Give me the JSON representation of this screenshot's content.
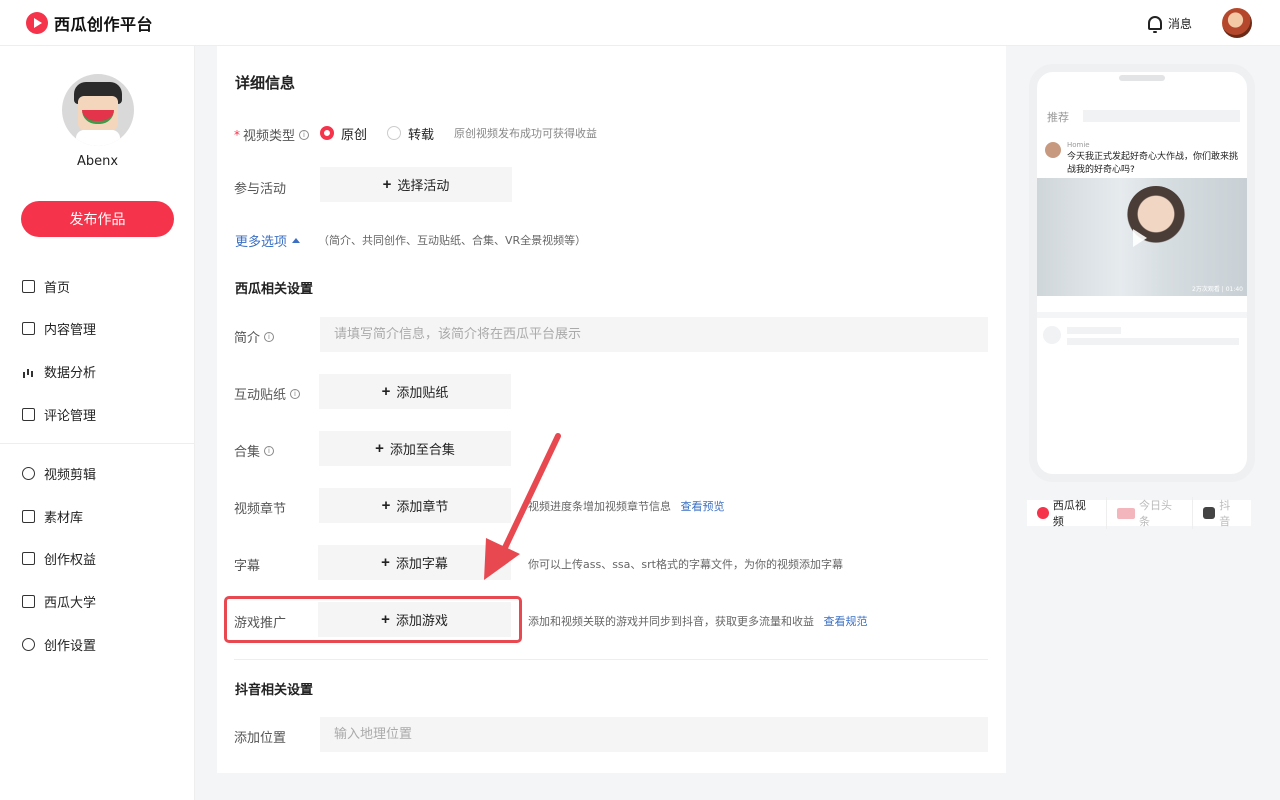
{
  "brand": {
    "name": "西瓜创作平台"
  },
  "topbar": {
    "messages_label": "消息"
  },
  "sidebar": {
    "username": "Abenx",
    "publish_label": "发布作品",
    "nav_group1": [
      {
        "label": "首页",
        "icon": "home-icon"
      },
      {
        "label": "内容管理",
        "icon": "content-icon"
      },
      {
        "label": "数据分析",
        "icon": "chart-icon"
      },
      {
        "label": "评论管理",
        "icon": "comment-icon"
      }
    ],
    "nav_group2": [
      {
        "label": "视频剪辑",
        "icon": "scissors-icon"
      },
      {
        "label": "素材库",
        "icon": "layers-icon"
      },
      {
        "label": "创作权益",
        "icon": "crown-icon"
      },
      {
        "label": "西瓜大学",
        "icon": "presentation-icon"
      },
      {
        "label": "创作设置",
        "icon": "settings-icon"
      }
    ]
  },
  "form": {
    "title": "详细信息",
    "video_type": {
      "label": "视频类型",
      "options": [
        "原创",
        "转载"
      ],
      "selected": "原创",
      "hint": "原创视频发布成功可获得收益"
    },
    "activity": {
      "label": "参与活动",
      "button": "选择活动"
    },
    "more_options": {
      "label": "更多选项",
      "hint": "（简介、共同创作、互动贴纸、合集、VR全景视频等）"
    },
    "xigua_section": "西瓜相关设置",
    "intro": {
      "label": "简介",
      "placeholder": "请填写简介信息，该简介将在西瓜平台展示"
    },
    "sticker": {
      "label": "互动贴纸",
      "button": "添加贴纸"
    },
    "collection": {
      "label": "合集",
      "button": "添加至合集"
    },
    "chapter": {
      "label": "视频章节",
      "button": "添加章节",
      "hint": "视频进度条增加视频章节信息",
      "link": "查看预览"
    },
    "subtitle": {
      "label": "字幕",
      "button": "添加字幕",
      "hint": "你可以上传ass、ssa、srt格式的字幕文件，为你的视频添加字幕"
    },
    "game": {
      "label": "游戏推广",
      "button": "添加游戏",
      "hint": "添加和视频关联的游戏并同步到抖音，获取更多流量和收益",
      "link": "查看规范"
    },
    "douyin_section": "抖音相关设置",
    "location": {
      "label": "添加位置",
      "placeholder": "输入地理位置"
    }
  },
  "preview": {
    "tab_label": "推荐",
    "author": "Homie",
    "post_text": "今天我正式发起好奇心大作战，你们敢来挑战我的好奇心吗?",
    "video_meta": "2万次观看 | 01:40",
    "platforms": [
      "西瓜视频",
      "今日头条",
      "抖音"
    ]
  },
  "colors": {
    "accent": "#f5334a",
    "link": "#3a6fc4",
    "highlight": "#e8484f"
  }
}
